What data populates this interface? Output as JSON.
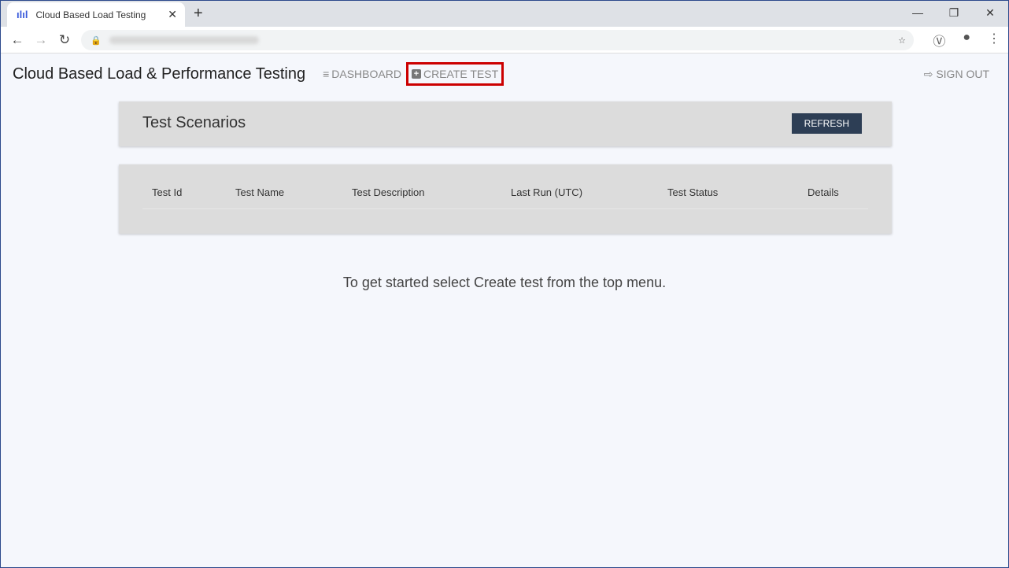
{
  "browser": {
    "tab_title": "Cloud Based Load Testing",
    "close": "✕",
    "new_tab": "+",
    "min": "—",
    "restore": "❐",
    "close_win": "✕"
  },
  "app": {
    "title": "Cloud Based Load & Performance Testing",
    "dashboard": "DASHBOARD",
    "create_test": "CREATE TEST",
    "sign_out": "SIGN OUT"
  },
  "scenarios": {
    "title": "Test Scenarios",
    "refresh": "REFRESH"
  },
  "table": {
    "columns": [
      "Test Id",
      "Test Name",
      "Test Description",
      "Last Run (UTC)",
      "Test Status",
      "Details"
    ]
  },
  "message": "To get started select Create test from the top menu."
}
